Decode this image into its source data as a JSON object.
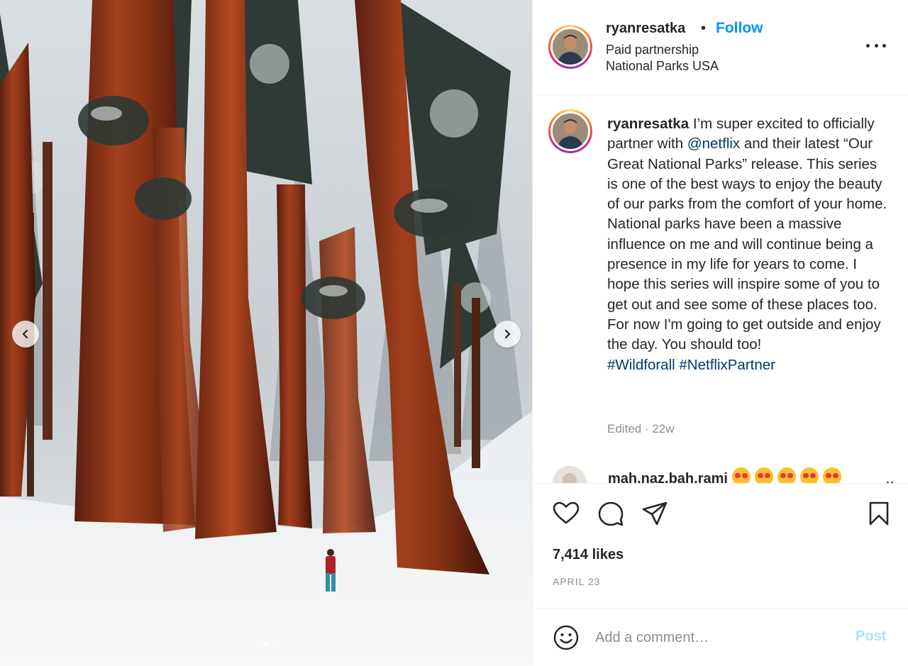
{
  "photo": {
    "description_icon": "photo",
    "slide_count": 3,
    "active_slide": 1
  },
  "header": {
    "username": "ryanresatka",
    "separator": "•",
    "follow_label": "Follow",
    "partnership": "Paid partnership",
    "location": "National Parks USA"
  },
  "caption": {
    "username": "ryanresatka",
    "text_1": " I’m super excited to officially partner with ",
    "mention": "@netflix",
    "text_2": " and their latest “Our Great National Parks” release. This series is one of the best ways to enjoy the beauty of our parks from the comfort of your home. National parks have been a massive influence on me and will continue being a presence in my life for years to come. I hope this series will inspire some of you to get out and see some of these places too. For now I'm going to get outside and enjoy the day. You should too!",
    "hashtags": "#Wildforall #NetflixPartner",
    "edited": "Edited · 22w"
  },
  "comment_preview": {
    "username": "mah.naz.bah.rami",
    "emoji_count": 5,
    "more": "··"
  },
  "actions": {
    "likes": "7,414 likes",
    "date": "APRIL 23"
  },
  "comment_bar": {
    "placeholder": "Add a comment…",
    "post_label": "Post"
  },
  "colors": {
    "follow": "#0095f6",
    "mention": "#00376b",
    "post_disabled": "#b2dffc",
    "muted": "#8e8e8e"
  }
}
